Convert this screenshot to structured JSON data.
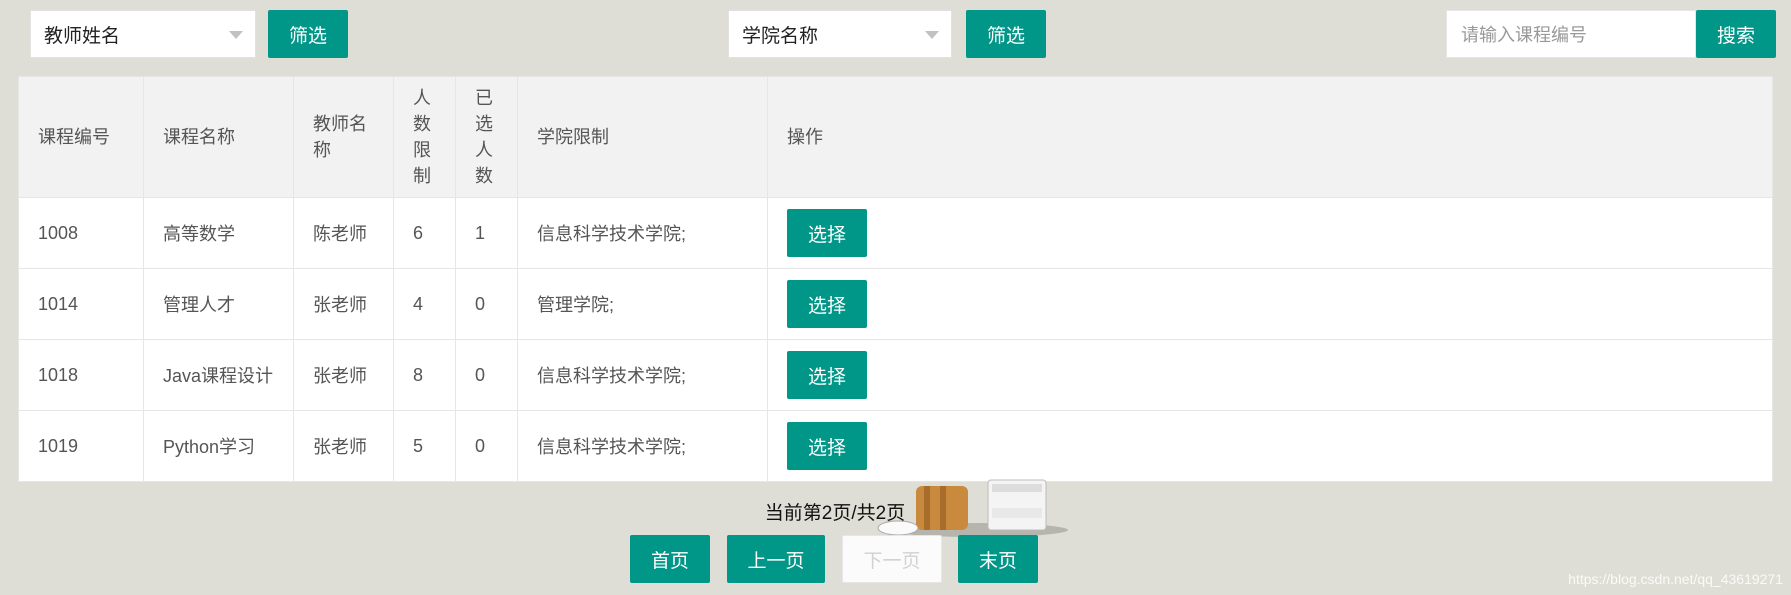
{
  "filters": {
    "teacher_select": "教师姓名",
    "teacher_filter_label": "筛选",
    "college_select": "学院名称",
    "college_filter_label": "筛选",
    "course_search_placeholder": "请输入课程编号",
    "search_label": "搜索"
  },
  "table": {
    "headers": [
      "课程编号",
      "课程名称",
      "教师名称",
      "人数限制",
      "已选人数",
      "学院限制",
      "操作"
    ],
    "rows": [
      {
        "id": "1008",
        "name": "高等数学",
        "teacher": "陈老师",
        "limit": "6",
        "selected": "1",
        "college": "信息科学技术学院;",
        "action": "选择"
      },
      {
        "id": "1014",
        "name": "管理人才",
        "teacher": "张老师",
        "limit": "4",
        "selected": "0",
        "college": "管理学院;",
        "action": "选择"
      },
      {
        "id": "1018",
        "name": "Java课程设计",
        "teacher": "张老师",
        "limit": "8",
        "selected": "0",
        "college": "信息科学技术学院;",
        "action": "选择"
      },
      {
        "id": "1019",
        "name": "Python学习",
        "teacher": "张老师",
        "limit": "5",
        "selected": "0",
        "college": "信息科学技术学院;",
        "action": "选择"
      }
    ]
  },
  "pagination": {
    "info": "当前第2页/共2页",
    "first": "首页",
    "prev": "上一页",
    "next": "下一页",
    "last": "末页"
  },
  "watermark": "https://blog.csdn.net/qq_43619271",
  "colors": {
    "accent": "#009688",
    "background": "#deded6"
  }
}
